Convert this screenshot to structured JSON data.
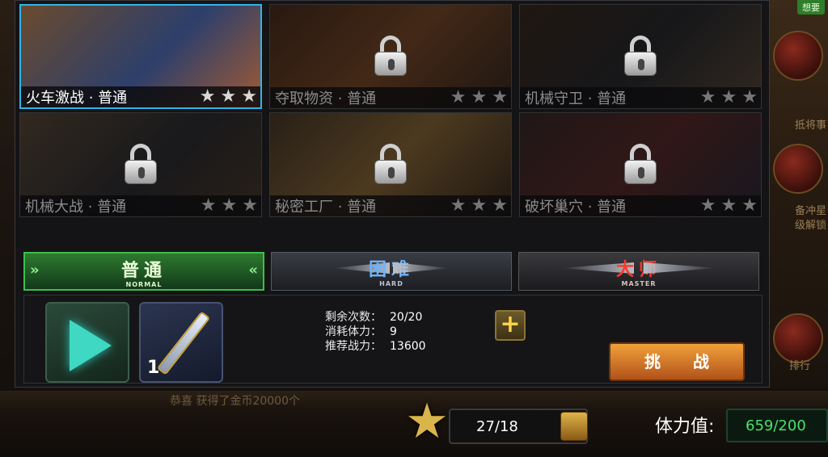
{
  "stages": [
    {
      "name": "火车激战 · 普通",
      "locked": false,
      "selected": true,
      "stars": 3
    },
    {
      "name": "夺取物资 · 普通",
      "locked": true,
      "selected": false,
      "stars": 3
    },
    {
      "name": "机械守卫 · 普通",
      "locked": true,
      "selected": false,
      "stars": 3
    },
    {
      "name": "机械大战 · 普通",
      "locked": true,
      "selected": false,
      "stars": 3
    },
    {
      "name": "秘密工厂 · 普通",
      "locked": true,
      "selected": false,
      "stars": 3
    },
    {
      "name": "破坏巢穴 · 普通",
      "locked": true,
      "selected": false,
      "stars": 3
    }
  ],
  "difficulty": {
    "normal": {
      "zh": "普通",
      "en": "NORMAL",
      "active": true
    },
    "hard": {
      "zh": "困难",
      "en": "HARD",
      "active": false
    },
    "master": {
      "zh": "大师",
      "en": "MASTER",
      "active": false
    }
  },
  "rewards": [
    {
      "icon": "crystal-gem-icon"
    },
    {
      "icon": "sword-icon",
      "count": "1"
    }
  ],
  "info": {
    "remaining_label": "剩余次数：",
    "remaining_value": "20/20",
    "cost_label": "消耗体力：",
    "cost_value": "9",
    "power_label": "推荐战力：",
    "power_value": "13600"
  },
  "buttons": {
    "plus": "+",
    "challenge": "挑战"
  },
  "bottom": {
    "star_count": "27/18",
    "stamina_label": "体力值:",
    "stamina_value": "659/200",
    "scroll_text": "恭喜 获得了金币20000个"
  },
  "background_right": {
    "tag": "想要",
    "faint_1": "抵将事",
    "faint_2": "备冲星",
    "faint_3": "级解锁",
    "faint_4": "排行"
  },
  "colors": {
    "selected_border": "#2fb5e8",
    "normal_tab": "#3fbf4a",
    "hard_text": "#6fb4ff",
    "master_text": "#ff3a2a",
    "stamina_value": "#49e06a"
  }
}
